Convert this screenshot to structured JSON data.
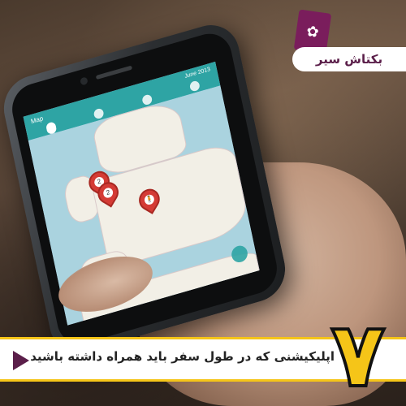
{
  "brand": {
    "name": "بکتاش سیر",
    "logo_glyph": "✿"
  },
  "app": {
    "title": "Map",
    "date": "June 2013"
  },
  "markers": [
    {
      "label": "2"
    },
    {
      "label": "2"
    },
    {
      "label": "🧍"
    }
  ],
  "caption": {
    "number": "۷",
    "text": "اپلیکیشنی که در طول سفر باید همراه داشته باشید"
  },
  "colors": {
    "accent_yellow": "#f5c518",
    "brand_purple": "#5b1f4a",
    "app_teal": "#2ea4a4",
    "marker_red": "#d43b35"
  }
}
